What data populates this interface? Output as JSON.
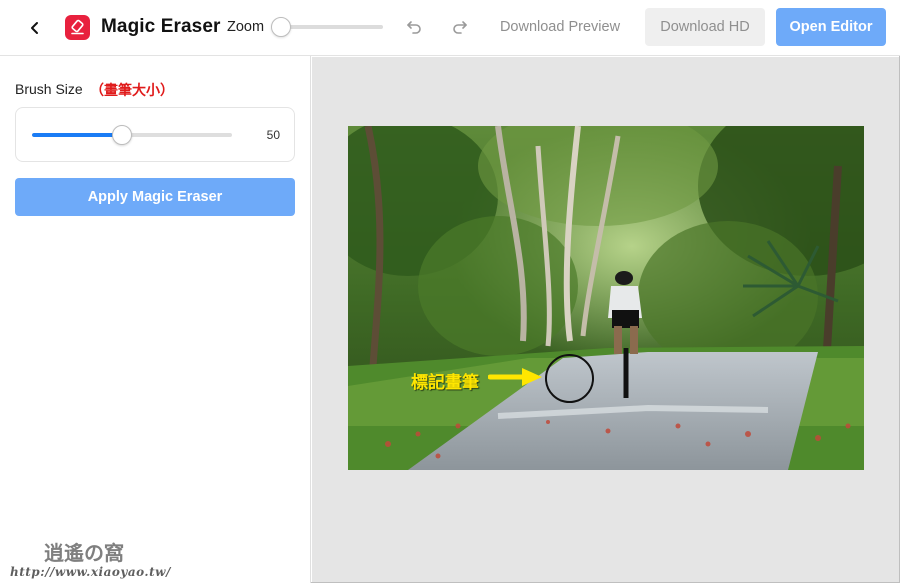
{
  "header": {
    "app_title": "Magic Eraser",
    "zoom_label": "Zoom",
    "zoom_level": 0,
    "download_preview_label": "Download Preview",
    "download_hd_label": "Download HD",
    "open_editor_label": "Open Editor",
    "icons": {
      "back": "chevron-left-icon",
      "logo": "magic-eraser-logo-icon",
      "undo": "undo-icon",
      "redo": "redo-icon"
    }
  },
  "sidebar": {
    "brush_label": "Brush Size",
    "brush_annotation": "（畫筆大小）",
    "brush_value": "50",
    "brush_fraction": 0.45,
    "apply_label": "Apply Magic Eraser"
  },
  "canvas": {
    "annotation_label": "標記畫筆",
    "photo_subject": "cyclist on tree-lined path",
    "colors": {
      "accent": "#1a7cf5",
      "button_blue": "#6eaaf9",
      "logo_red": "#e8213e",
      "annotation_red": "#e01b1b",
      "annotation_yellow": "#ffe600"
    }
  },
  "watermark": {
    "title": "逍遙の窩",
    "url": "http://www.xiaoyao.tw/"
  }
}
